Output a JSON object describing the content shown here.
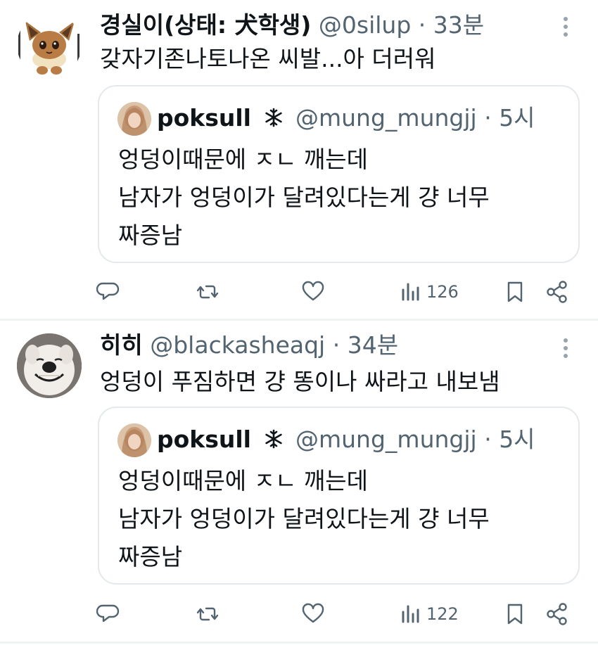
{
  "tweets": [
    {
      "name": "경실이(상태: 犬학생)",
      "handle": "@0silup",
      "dot": "·",
      "time": "33분",
      "text": "갖자기존나토나온 씨발...아 더러워",
      "avatar": "eevee-avatar",
      "quote": {
        "name": "poksull",
        "badge": "snowflake-icon",
        "handle": "@mung_mungjj",
        "dot": "·",
        "time": "5시",
        "lines": [
          "엉덩이때문에 ㅈㄴ 깨는데",
          "남자가 엉덩이가 달려있다는게 걍 너무",
          "짜증남"
        ]
      },
      "actions": {
        "views": "126"
      }
    },
    {
      "name": "히히",
      "handle": "@blackasheaqj",
      "dot": "·",
      "time": "34분",
      "text": "엉덩이 푸짐하면 걍 똥이나 싸라고 내보냄",
      "avatar": "smiling-dog-avatar",
      "quote": {
        "name": "poksull",
        "badge": "snowflake-icon",
        "handle": "@mung_mungjj",
        "dot": "·",
        "time": "5시",
        "lines": [
          "엉덩이때문에 ㅈㄴ 깨는데",
          "남자가 엉덩이가 달려있다는게 걍 너무",
          "짜증남"
        ]
      },
      "actions": {
        "views": "122"
      }
    }
  ],
  "colors": {
    "text": "#0f1419",
    "secondary": "#536471",
    "border": "#e4e9ec",
    "separator": "#eff3f4"
  },
  "icons": [
    "reply-icon",
    "retweet-icon",
    "like-icon",
    "views-icon",
    "bookmark-icon",
    "share-icon",
    "more-icon"
  ]
}
